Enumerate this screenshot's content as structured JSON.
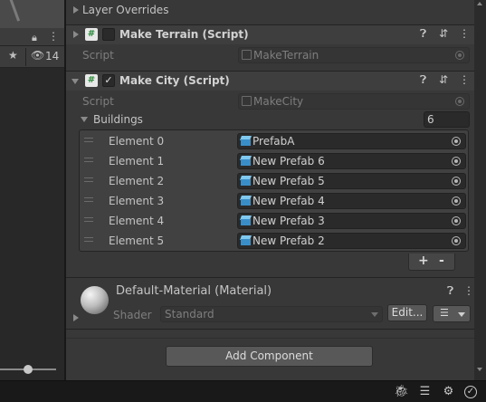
{
  "left_panel": {
    "visibility_count": "14"
  },
  "inspector": {
    "layer_overrides": "Layer Overrides",
    "components": [
      {
        "title": "Make Terrain (Script)",
        "enabled": false,
        "script_label": "Script",
        "script_value": "MakeTerrain"
      },
      {
        "title": "Make City (Script)",
        "enabled": true,
        "script_label": "Script",
        "script_value": "MakeCity"
      }
    ],
    "buildings": {
      "label": "Buildings",
      "size": "6",
      "elements": [
        {
          "label": "Element 0",
          "value": "PrefabA"
        },
        {
          "label": "Element 1",
          "value": "New Prefab 6"
        },
        {
          "label": "Element 2",
          "value": "New Prefab 5"
        },
        {
          "label": "Element 3",
          "value": "New Prefab 4"
        },
        {
          "label": "Element 4",
          "value": "New Prefab 3"
        },
        {
          "label": "Element 5",
          "value": "New Prefab 2"
        }
      ],
      "add": "+",
      "remove": "-"
    },
    "material": {
      "title": "Default-Material (Material)",
      "shader_label": "Shader",
      "shader_value": "Standard",
      "edit_label": "Edit..."
    },
    "add_component": "Add Component"
  },
  "colors": {
    "background": "#383838",
    "header": "#3e3e3e",
    "field": "#2a2a2a",
    "prefab_icon": "#3a8ec8"
  }
}
